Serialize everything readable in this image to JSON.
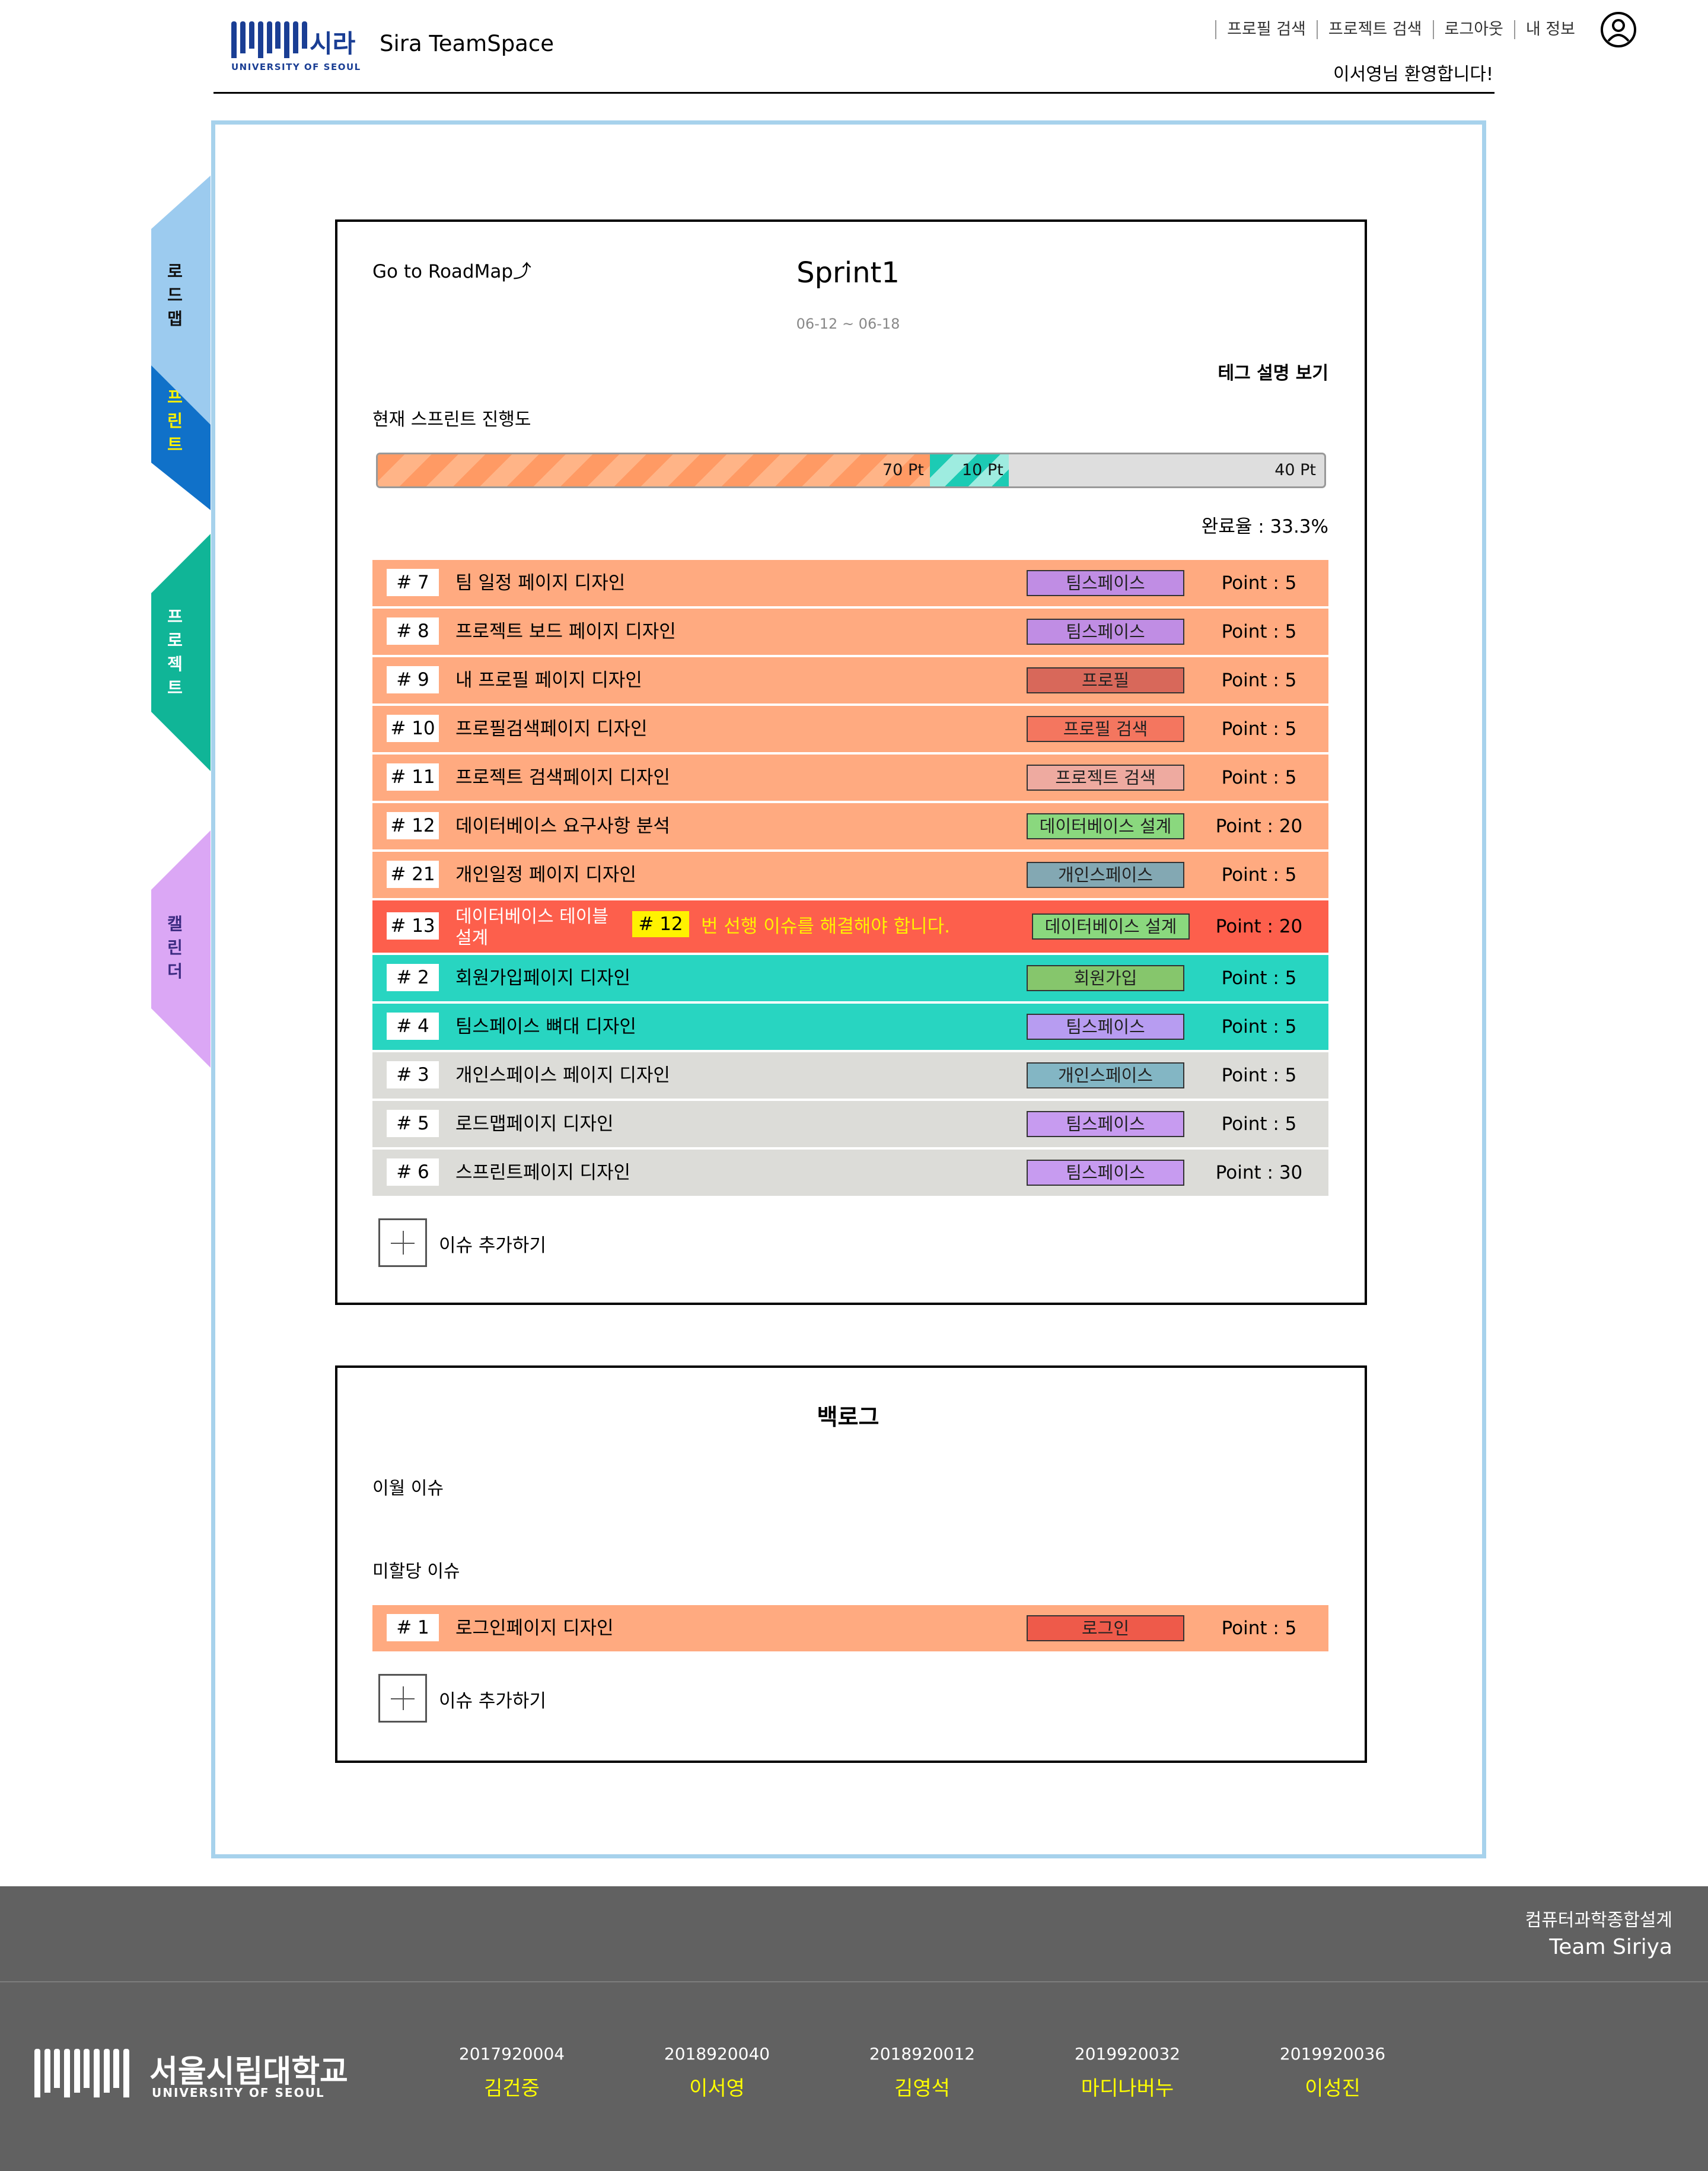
{
  "header": {
    "logo_text": "시라",
    "logo_sub": "UNIVERSITY OF SEOUL",
    "app_title": "Sira TeamSpace",
    "nav": [
      "프로필 검색",
      "프로젝트 검색",
      "로그아웃",
      "내 정보"
    ],
    "welcome": "이서영님 환영합니다!"
  },
  "sidebar": {
    "tabs": [
      {
        "label": "로드맵",
        "color": "#9ccbef",
        "text_color": "#111111"
      },
      {
        "label": "스프린트",
        "color": "#1071c9",
        "text_color": "#fff200"
      },
      {
        "label": "프로젝트",
        "color": "#10b597",
        "text_color": "#ffffff"
      },
      {
        "label": "캘린더",
        "color": "#dba7f5",
        "text_color": "#3a2a80"
      }
    ]
  },
  "sprint": {
    "goto_roadmap": "Go to RoadMap",
    "title": "Sprint1",
    "dates": "06-12 ~ 06-18",
    "tag_help": "테그 설명 보기",
    "progress_label": "현재 스프린트 진행도",
    "progress": {
      "done_pt": 70,
      "in_progress_pt": 10,
      "todo_pt": 40,
      "done_label": "70 Pt",
      "in_progress_label": "10 Pt",
      "todo_label": "40 Pt"
    },
    "completion": "완료율 : 33.3%",
    "add_issue": "이슈 추가하기",
    "issues": [
      {
        "id": "# 7",
        "title": "팀 일정 페이지 디자인",
        "tag": "팀스페이스",
        "tag_color": "#c08de4",
        "point": "Point : 5",
        "status": "todo"
      },
      {
        "id": "# 8",
        "title": "프로젝트 보드 페이지 디자인",
        "tag": "팀스페이스",
        "tag_color": "#c08de4",
        "point": "Point : 5",
        "status": "todo"
      },
      {
        "id": "# 9",
        "title": "내 프로필 페이지 디자인",
        "tag": "프로필",
        "tag_color": "#d8685a",
        "point": "Point : 5",
        "status": "todo"
      },
      {
        "id": "# 10",
        "title": "프로필검색페이지 디자인",
        "tag": "프로필 검색",
        "tag_color": "#f4765f",
        "point": "Point : 5",
        "status": "todo"
      },
      {
        "id": "# 11",
        "title": "프로젝트 검색페이지 디자인",
        "tag": "프로젝트 검색",
        "tag_color": "#eeaaa0",
        "point": "Point : 5",
        "status": "todo"
      },
      {
        "id": "# 12",
        "title": "데이터베이스 요구사항 분석",
        "tag": "데이터베이스 설계",
        "tag_color": "#8ad87e",
        "point": "Point : 20",
        "status": "todo"
      },
      {
        "id": "# 21",
        "title": "개인일정 페이지 디자인",
        "tag": "개인스페이스",
        "tag_color": "#83a8b3",
        "point": "Point : 5",
        "status": "todo"
      },
      {
        "id": "# 13",
        "title": "데이터베이스 테이블 설계",
        "tag": "데이터베이스 설계",
        "tag_color": "#8ad87e",
        "point": "Point : 20",
        "status": "blocked",
        "prereq_id": "# 12",
        "prereq_msg": "번 선행 이슈를 해결해야 합니다."
      },
      {
        "id": "# 2",
        "title": "회원가입페이지 디자인",
        "tag": "회원가입",
        "tag_color": "#86c66c",
        "point": "Point : 5",
        "status": "progress"
      },
      {
        "id": "# 4",
        "title": "팀스페이스 뼈대 디자인",
        "tag": "팀스페이스",
        "tag_color": "#b79cf1",
        "point": "Point : 5",
        "status": "progress"
      },
      {
        "id": "# 3",
        "title": "개인스페이스 페이지 디자인",
        "tag": "개인스페이스",
        "tag_color": "#83b6c4",
        "point": "Point : 5",
        "status": "done"
      },
      {
        "id": "# 5",
        "title": "로드맵페이지 디자인",
        "tag": "팀스페이스",
        "tag_color": "#c79bf0",
        "point": "Point : 5",
        "status": "done"
      },
      {
        "id": "# 6",
        "title": "스프린트페이지 디자인",
        "tag": "팀스페이스",
        "tag_color": "#c79bf0",
        "point": "Point : 30",
        "status": "done"
      }
    ]
  },
  "backlog": {
    "title": "백로그",
    "overdue_label": "이월 이슈",
    "unassigned_label": "미할당 이슈",
    "add_issue": "이슈 추가하기",
    "issues": [
      {
        "id": "# 1",
        "title": "로그인페이지 디자인",
        "tag": "로그인",
        "tag_color": "#ee5a4a",
        "point": "Point : 5",
        "status": "todo"
      }
    ]
  },
  "status_colors": {
    "todo": "#ffaa80",
    "blocked": "#fd5f4c",
    "progress": "#28d5c1",
    "done": "#dcdcd8"
  },
  "footer": {
    "course": "컴퓨터과학종합설계",
    "team": "Team Siriya",
    "university": "서울시립대학교",
    "university_en": "UNIVERSITY OF SEOUL",
    "members": [
      {
        "id": "2017920004",
        "name": "김건중"
      },
      {
        "id": "2018920040",
        "name": "이서영"
      },
      {
        "id": "2018920012",
        "name": "김영석"
      },
      {
        "id": "2019920032",
        "name": "마디나버누"
      },
      {
        "id": "2019920036",
        "name": "이성진"
      }
    ]
  }
}
